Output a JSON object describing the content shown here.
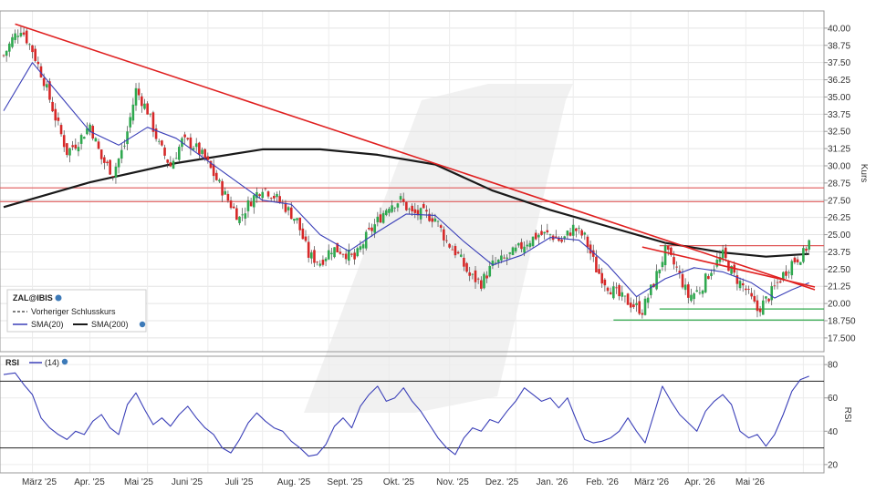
{
  "chart_data": [
    {
      "type": "candlestick",
      "symbol": "ZAL@IBIS",
      "ylabel": "Kurs",
      "ylim": [
        16.5,
        41.25
      ],
      "yticks": [
        {
          "v": 40.0,
          "label": "40.00"
        },
        {
          "v": 38.75,
          "label": "38.75"
        },
        {
          "v": 37.5,
          "label": "37.50"
        },
        {
          "v": 36.25,
          "label": "36.25"
        },
        {
          "v": 35.0,
          "label": "35.00"
        },
        {
          "v": 33.75,
          "label": "33.75"
        },
        {
          "v": 32.5,
          "label": "32.50"
        },
        {
          "v": 31.25,
          "label": "31.25"
        },
        {
          "v": 30.0,
          "label": "30.00"
        },
        {
          "v": 28.75,
          "label": "28.75"
        },
        {
          "v": 27.5,
          "label": "27.50"
        },
        {
          "v": 26.25,
          "label": "26.25"
        },
        {
          "v": 25.0,
          "label": "25.00"
        },
        {
          "v": 23.75,
          "label": "23.75"
        },
        {
          "v": 22.5,
          "label": "22.50"
        },
        {
          "v": 21.25,
          "label": "21.25"
        },
        {
          "v": 20.0,
          "label": "20.00"
        },
        {
          "v": 18.75,
          "label": "18.750"
        },
        {
          "v": 17.5,
          "label": "17.500"
        }
      ],
      "months": [
        "März '25",
        "Apr. '25",
        "Mai '25",
        "Juni '25",
        "Juli '25",
        "Aug. '25",
        "Sept. '25",
        "Okt. '25",
        "Nov. '25",
        "Dez. '25",
        "Jan. '26",
        "Feb. '26",
        "März '26",
        "Apr. '26",
        "Mai '26"
      ],
      "price_path": [
        [
          0,
          38.0
        ],
        [
          3,
          39.2
        ],
        [
          6,
          40.0
        ],
        [
          10,
          38.4
        ],
        [
          14,
          36.2
        ],
        [
          18,
          33.5
        ],
        [
          22,
          31.0
        ],
        [
          26,
          31.8
        ],
        [
          30,
          33.0
        ],
        [
          34,
          30.5
        ],
        [
          38,
          29.5
        ],
        [
          42,
          31.5
        ],
        [
          46,
          35.5
        ],
        [
          50,
          34.0
        ],
        [
          54,
          31.5
        ],
        [
          58,
          30.0
        ],
        [
          62,
          31.8
        ],
        [
          66,
          31.5
        ],
        [
          70,
          30.5
        ],
        [
          74,
          29.0
        ],
        [
          78,
          27.5
        ],
        [
          82,
          26.2
        ],
        [
          86,
          27.5
        ],
        [
          90,
          28.5
        ],
        [
          94,
          27.8
        ],
        [
          98,
          27.0
        ],
        [
          102,
          26.0
        ],
        [
          106,
          23.5
        ],
        [
          110,
          23.0
        ],
        [
          114,
          24.0
        ],
        [
          118,
          23.8
        ],
        [
          122,
          23.2
        ],
        [
          126,
          24.8
        ],
        [
          130,
          26.0
        ],
        [
          134,
          27.2
        ],
        [
          138,
          27.5
        ],
        [
          142,
          26.5
        ],
        [
          146,
          26.5
        ],
        [
          150,
          26.2
        ],
        [
          154,
          24.5
        ],
        [
          158,
          23.5
        ],
        [
          162,
          22.0
        ],
        [
          166,
          21.5
        ],
        [
          170,
          22.8
        ],
        [
          174,
          23.2
        ],
        [
          178,
          23.8
        ],
        [
          182,
          24.5
        ],
        [
          186,
          25.0
        ],
        [
          190,
          25.0
        ],
        [
          194,
          24.5
        ],
        [
          198,
          25.5
        ],
        [
          202,
          24.8
        ],
        [
          206,
          22.5
        ],
        [
          210,
          21.3
        ],
        [
          214,
          20.5
        ],
        [
          218,
          20.0
        ],
        [
          222,
          19.5
        ],
        [
          226,
          21.5
        ],
        [
          230,
          23.8
        ],
        [
          234,
          22.5
        ],
        [
          238,
          20.5
        ],
        [
          242,
          21.0
        ],
        [
          246,
          22.5
        ],
        [
          250,
          23.5
        ],
        [
          254,
          22.0
        ],
        [
          258,
          21.0
        ],
        [
          262,
          19.5
        ],
        [
          266,
          20.5
        ],
        [
          270,
          21.8
        ],
        [
          274,
          23.0
        ],
        [
          278,
          23.6
        ],
        [
          280,
          24.5
        ]
      ],
      "series": [
        {
          "name": "Vorheriger Schlusskurs",
          "color": "#555555",
          "style": "dashed"
        },
        {
          "name": "SMA(20)",
          "color": "#3a3fb8",
          "points": [
            [
              0,
              34.0
            ],
            [
              10,
              37.5
            ],
            [
              20,
              35.0
            ],
            [
              30,
              32.5
            ],
            [
              40,
              31.5
            ],
            [
              50,
              32.8
            ],
            [
              60,
              32.0
            ],
            [
              70,
              30.5
            ],
            [
              80,
              29.0
            ],
            [
              90,
              27.5
            ],
            [
              100,
              27.2
            ],
            [
              110,
              25.0
            ],
            [
              120,
              23.8
            ],
            [
              130,
              25.2
            ],
            [
              140,
              26.5
            ],
            [
              150,
              26.4
            ],
            [
              160,
              24.5
            ],
            [
              170,
              22.8
            ],
            [
              180,
              23.5
            ],
            [
              190,
              24.8
            ],
            [
              200,
              24.6
            ],
            [
              210,
              22.8
            ],
            [
              220,
              20.5
            ],
            [
              230,
              21.8
            ],
            [
              240,
              22.6
            ],
            [
              250,
              22.3
            ],
            [
              260,
              21.5
            ],
            [
              268,
              20.4
            ],
            [
              274,
              21.0
            ],
            [
              280,
              21.5
            ]
          ]
        },
        {
          "name": "SMA(200)",
          "color": "#1a1a1a",
          "points": [
            [
              0,
              27.0
            ],
            [
              30,
              28.8
            ],
            [
              60,
              30.2
            ],
            [
              90,
              31.2
            ],
            [
              110,
              31.2
            ],
            [
              130,
              30.8
            ],
            [
              150,
              30.1
            ],
            [
              170,
              28.2
            ],
            [
              190,
              26.8
            ],
            [
              210,
              25.6
            ],
            [
              230,
              24.4
            ],
            [
              250,
              23.7
            ],
            [
              265,
              23.4
            ],
            [
              280,
              23.6
            ]
          ]
        }
      ],
      "trendlines": [
        {
          "from": [
            4,
            40.3
          ],
          "to": [
            282,
            21.0
          ],
          "color": "#e02020"
        },
        {
          "from": [
            222,
            24.1
          ],
          "to": [
            282,
            21.2
          ],
          "color": "#e02020"
        }
      ],
      "hlines_red": [
        28.4,
        27.4,
        24.2
      ],
      "hlines_green": [
        19.6,
        18.8
      ]
    },
    {
      "type": "line",
      "name": "RSI",
      "param": "(14)",
      "ylabel": "RSI",
      "ylim": [
        15,
        85
      ],
      "yticks": [
        80,
        60,
        40,
        20
      ],
      "levels": [
        70,
        30
      ],
      "points": [
        [
          0,
          74
        ],
        [
          4,
          75
        ],
        [
          7,
          68
        ],
        [
          10,
          62
        ],
        [
          13,
          48
        ],
        [
          16,
          42
        ],
        [
          19,
          38
        ],
        [
          22,
          35
        ],
        [
          25,
          40
        ],
        [
          28,
          38
        ],
        [
          31,
          46
        ],
        [
          34,
          50
        ],
        [
          37,
          42
        ],
        [
          40,
          38
        ],
        [
          43,
          56
        ],
        [
          46,
          63
        ],
        [
          49,
          53
        ],
        [
          52,
          44
        ],
        [
          55,
          48
        ],
        [
          58,
          43
        ],
        [
          61,
          50
        ],
        [
          64,
          55
        ],
        [
          67,
          48
        ],
        [
          70,
          42
        ],
        [
          73,
          38
        ],
        [
          76,
          30
        ],
        [
          79,
          27
        ],
        [
          82,
          35
        ],
        [
          85,
          45
        ],
        [
          88,
          51
        ],
        [
          91,
          46
        ],
        [
          94,
          42
        ],
        [
          97,
          40
        ],
        [
          100,
          34
        ],
        [
          103,
          30
        ],
        [
          106,
          25
        ],
        [
          109,
          26
        ],
        [
          112,
          32
        ],
        [
          115,
          43
        ],
        [
          118,
          48
        ],
        [
          121,
          42
        ],
        [
          124,
          55
        ],
        [
          127,
          62
        ],
        [
          130,
          67
        ],
        [
          133,
          58
        ],
        [
          136,
          60
        ],
        [
          139,
          66
        ],
        [
          142,
          58
        ],
        [
          145,
          52
        ],
        [
          148,
          44
        ],
        [
          151,
          36
        ],
        [
          154,
          30
        ],
        [
          157,
          26
        ],
        [
          160,
          36
        ],
        [
          163,
          42
        ],
        [
          166,
          40
        ],
        [
          169,
          47
        ],
        [
          172,
          45
        ],
        [
          175,
          52
        ],
        [
          178,
          58
        ],
        [
          181,
          66
        ],
        [
          184,
          62
        ],
        [
          187,
          58
        ],
        [
          190,
          60
        ],
        [
          193,
          54
        ],
        [
          196,
          60
        ],
        [
          199,
          47
        ],
        [
          202,
          35
        ],
        [
          205,
          33
        ],
        [
          208,
          34
        ],
        [
          211,
          36
        ],
        [
          214,
          40
        ],
        [
          217,
          48
        ],
        [
          220,
          40
        ],
        [
          223,
          33
        ],
        [
          226,
          50
        ],
        [
          229,
          67
        ],
        [
          232,
          58
        ],
        [
          235,
          50
        ],
        [
          238,
          45
        ],
        [
          241,
          40
        ],
        [
          244,
          52
        ],
        [
          247,
          58
        ],
        [
          250,
          62
        ],
        [
          253,
          56
        ],
        [
          256,
          40
        ],
        [
          259,
          36
        ],
        [
          262,
          38
        ],
        [
          265,
          31
        ],
        [
          268,
          38
        ],
        [
          271,
          50
        ],
        [
          274,
          64
        ],
        [
          277,
          71
        ],
        [
          280,
          73
        ]
      ]
    }
  ]
}
